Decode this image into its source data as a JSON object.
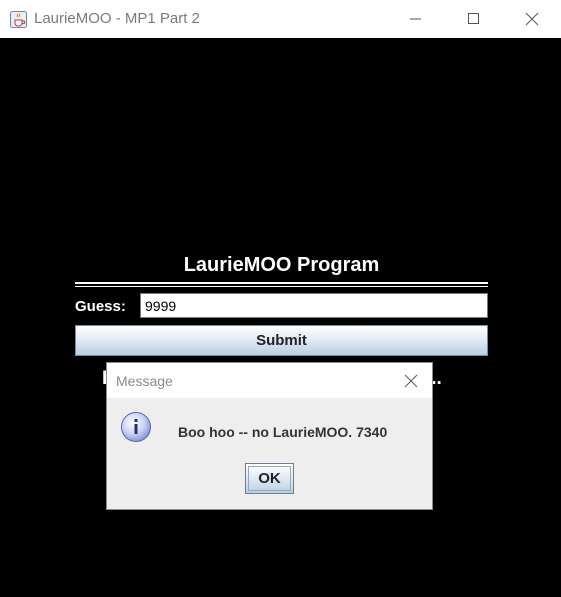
{
  "window": {
    "title": "LaurieMOO - MP1 Part 2",
    "controls": [
      "minimize-icon",
      "maximize-icon",
      "close-icon"
    ]
  },
  "program": {
    "title": "LaurieMOO Program",
    "guess_label": "Guess:",
    "guess_value": "9999",
    "submit_label": "Submit",
    "status_left_fragment": "I",
    "status_right_fragment": "..."
  },
  "dialog": {
    "title": "Message",
    "icon": "info-icon",
    "message": "Boo hoo -- no LaurieMOO. 7340",
    "ok_label": "OK"
  },
  "colors": {
    "background": "#000000",
    "text_on_dark": "#ffffff",
    "dialog_bg": "#eeeeee",
    "button_gradient_bottom": "#b8cfe5"
  }
}
